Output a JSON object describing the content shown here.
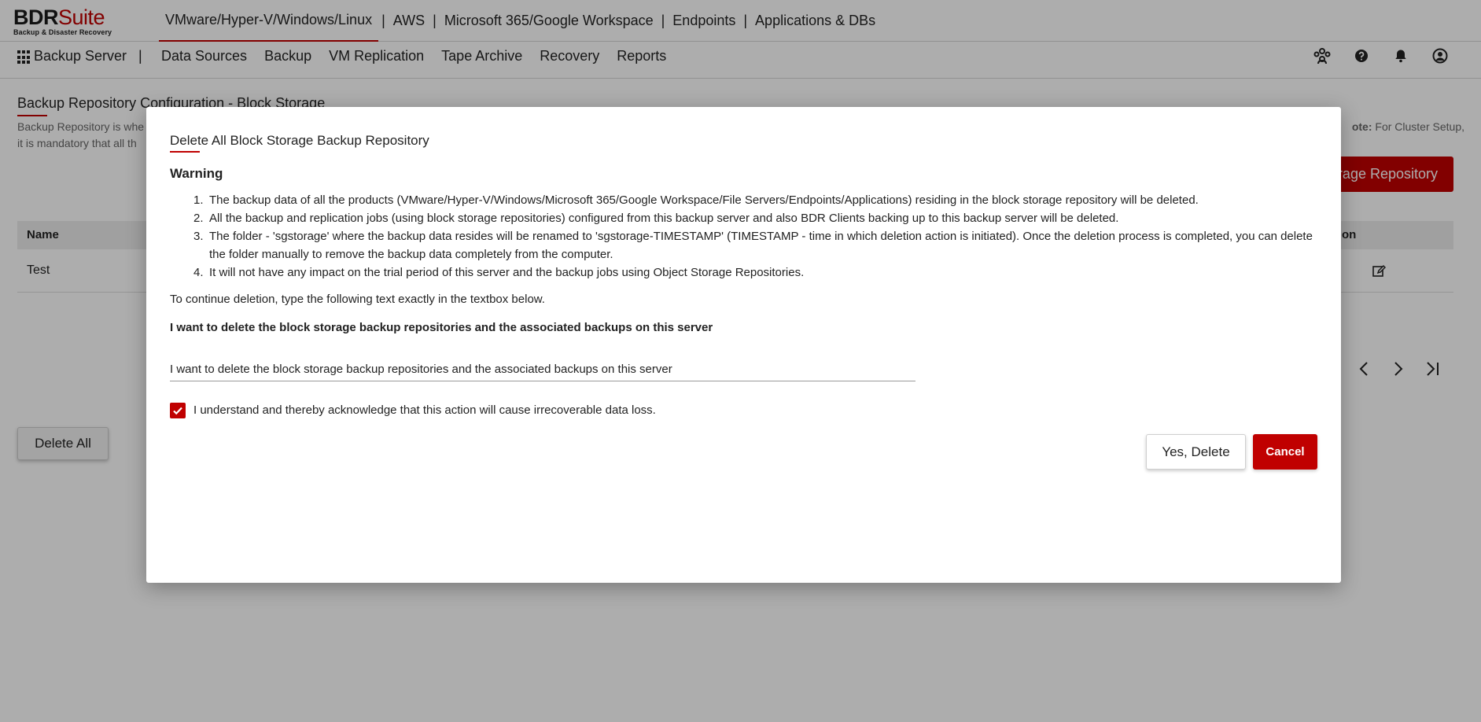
{
  "header": {
    "logo_main_bold": "BDR",
    "logo_main_light": "Suite",
    "logo_sub": "Backup & Disaster Recovery",
    "platforms": [
      "VMware/Hyper-V/Windows/Linux",
      "AWS",
      "Microsoft 365/Google Workspace",
      "Endpoints",
      "Applications & DBs"
    ],
    "separator": "|"
  },
  "subnav": {
    "title": "Backup Server",
    "separator": "|",
    "menu": [
      "Data Sources",
      "Backup",
      "VM Replication",
      "Tape Archive",
      "Recovery",
      "Reports"
    ],
    "icons": [
      "team-icon",
      "help-icon",
      "bell-icon",
      "user-icon"
    ]
  },
  "page": {
    "title": "Backup Repository Configuration - Block Storage",
    "desc_line1": "Backup Repository is whe",
    "desc_line2": "it is mandatory that all th",
    "note_prefix": "ote:",
    "note_text": " For Cluster Setup,",
    "add_button": "orage Repository",
    "table": {
      "col_name": "Name",
      "col_action": "on",
      "rows": [
        {
          "name": "Test"
        }
      ]
    },
    "delete_all_button": "Delete All"
  },
  "modal": {
    "title": "Delete All Block Storage Backup Repository",
    "warning_title": "Warning",
    "warnings": [
      {
        "num": "1.",
        "text": "The backup data of all the products (VMware/Hyper-V/Windows/Microsoft 365/Google Workspace/File Servers/Endpoints/Applications) residing in the block storage repository will be deleted."
      },
      {
        "num": "2.",
        "text": "All the backup and replication jobs (using block storage repositories) configured from this backup server and also BDR Clients backing up to this backup server will be deleted."
      },
      {
        "num": "3.",
        "text": "The folder - 'sgstorage' where the backup data resides will be renamed to 'sgstorage-TIMESTAMP' (TIMESTAMP - time in which deletion action is initiated). Once the deletion process is completed, you can delete the folder manually to remove the backup data completely from the computer."
      },
      {
        "num": "4.",
        "text": "It will not have any impact on the trial period of this server and the backup jobs using Object Storage Repositories."
      }
    ],
    "continue_text": "To continue deletion, type the following text exactly in the textbox below.",
    "confirm_text": "I want to delete the block storage backup repositories and the associated backups on this server",
    "input_value": "I want to delete the block storage backup repositories and the associated backups on this server",
    "ack_checked": true,
    "ack_label": "I understand and thereby acknowledge that this action will cause irrecoverable data loss.",
    "yes_button": "Yes, Delete",
    "cancel_button": "Cancel"
  },
  "colors": {
    "accent": "#c00000",
    "overlay": "rgba(0,0,0,0.32)"
  }
}
